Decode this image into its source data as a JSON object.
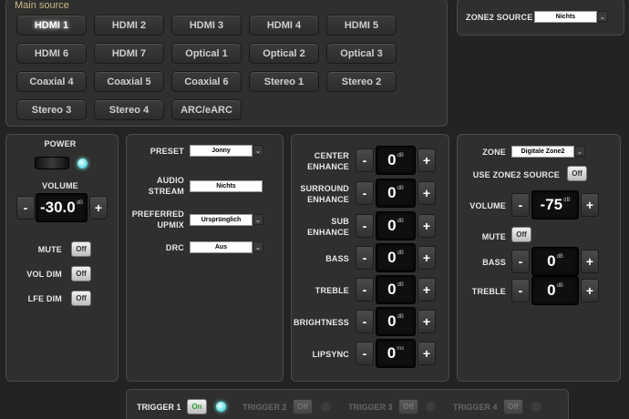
{
  "main_source": {
    "legend": "Main source",
    "sources": [
      "HDMI 1",
      "HDMI 2",
      "HDMI 3",
      "HDMI 4",
      "HDMI 5",
      "HDMI 6",
      "HDMI 7",
      "Optical 1",
      "Optical 2",
      "Optical 3",
      "Coaxial 4",
      "Coaxial 5",
      "Coaxial 6",
      "Stereo 1",
      "Stereo 2",
      "Stereo 3",
      "Stereo 4",
      "ARC/eARC"
    ],
    "active": "HDMI 1"
  },
  "zone2_source": {
    "label": "ZONE2 SOURCE",
    "value": "Nichts",
    "arrow": "⌄"
  },
  "power": {
    "power_label": "POWER",
    "volume_label": "VOLUME",
    "volume_value": "-30.0",
    "volume_unit": "dB",
    "minus": "-",
    "plus": "+",
    "mute_label": "MUTE",
    "mute_state": "Off",
    "voldim_label": "VOL DIM",
    "voldim_state": "Off",
    "lfedim_label": "LFE DIM",
    "lfedim_state": "Off"
  },
  "settings": {
    "preset_label": "PRESET",
    "preset_value": "Jonny",
    "audio_stream_label_1": "AUDIO",
    "audio_stream_label_2": "STREAM",
    "audio_stream_value": "Nichts",
    "upmix_label_1": "PREFERRED",
    "upmix_label_2": "UPMIX",
    "upmix_value": "Ursprünglich",
    "drc_label": "DRC",
    "drc_value": "Aus",
    "arrow": "⌄"
  },
  "enhance": {
    "minus": "-",
    "plus": "+",
    "rows": [
      {
        "label_1": "CENTER",
        "label_2": "ENHANCE",
        "value": "0",
        "unit": "dB"
      },
      {
        "label_1": "SURROUND",
        "label_2": "ENHANCE",
        "value": "0",
        "unit": "dB"
      },
      {
        "label_1": "SUB",
        "label_2": "ENHANCE",
        "value": "0",
        "unit": "dB"
      },
      {
        "label_1": "BASS",
        "label_2": "",
        "value": "0",
        "unit": "dB"
      },
      {
        "label_1": "TREBLE",
        "label_2": "",
        "value": "0",
        "unit": "dB"
      },
      {
        "label_1": "BRIGHTNESS",
        "label_2": "",
        "value": "0",
        "unit": "dB"
      },
      {
        "label_1": "LIPSYNC",
        "label_2": "",
        "value": "0",
        "unit": "ms"
      }
    ]
  },
  "zone2": {
    "zone_label": "ZONE",
    "zone_value": "Digitale Zone2",
    "arrow": "⌄",
    "use_label": "USE ZONE2 SOURCE",
    "use_state": "Off",
    "volume_label": "VOLUME",
    "volume_value": "-75",
    "volume_unit": "dB",
    "mute_label": "MUTE",
    "mute_state": "Off",
    "bass_label": "BASS",
    "bass_value": "0",
    "bass_unit": "dB",
    "treble_label": "TREBLE",
    "treble_value": "0",
    "treble_unit": "dB",
    "minus": "-",
    "plus": "+"
  },
  "triggers": {
    "t1_label": "TRIGGER 1",
    "t1_state": "On",
    "t2_label": "TRIGGER 2",
    "t2_state": "Off",
    "t3_label": "TRIGGER 3",
    "t3_state": "Off",
    "t4_label": "TRIGGER 4",
    "t4_state": "Off"
  },
  "colors": {
    "accent_led": "#66e0e6",
    "legend": "#c9b98a",
    "on_text": "#2aa22a"
  }
}
